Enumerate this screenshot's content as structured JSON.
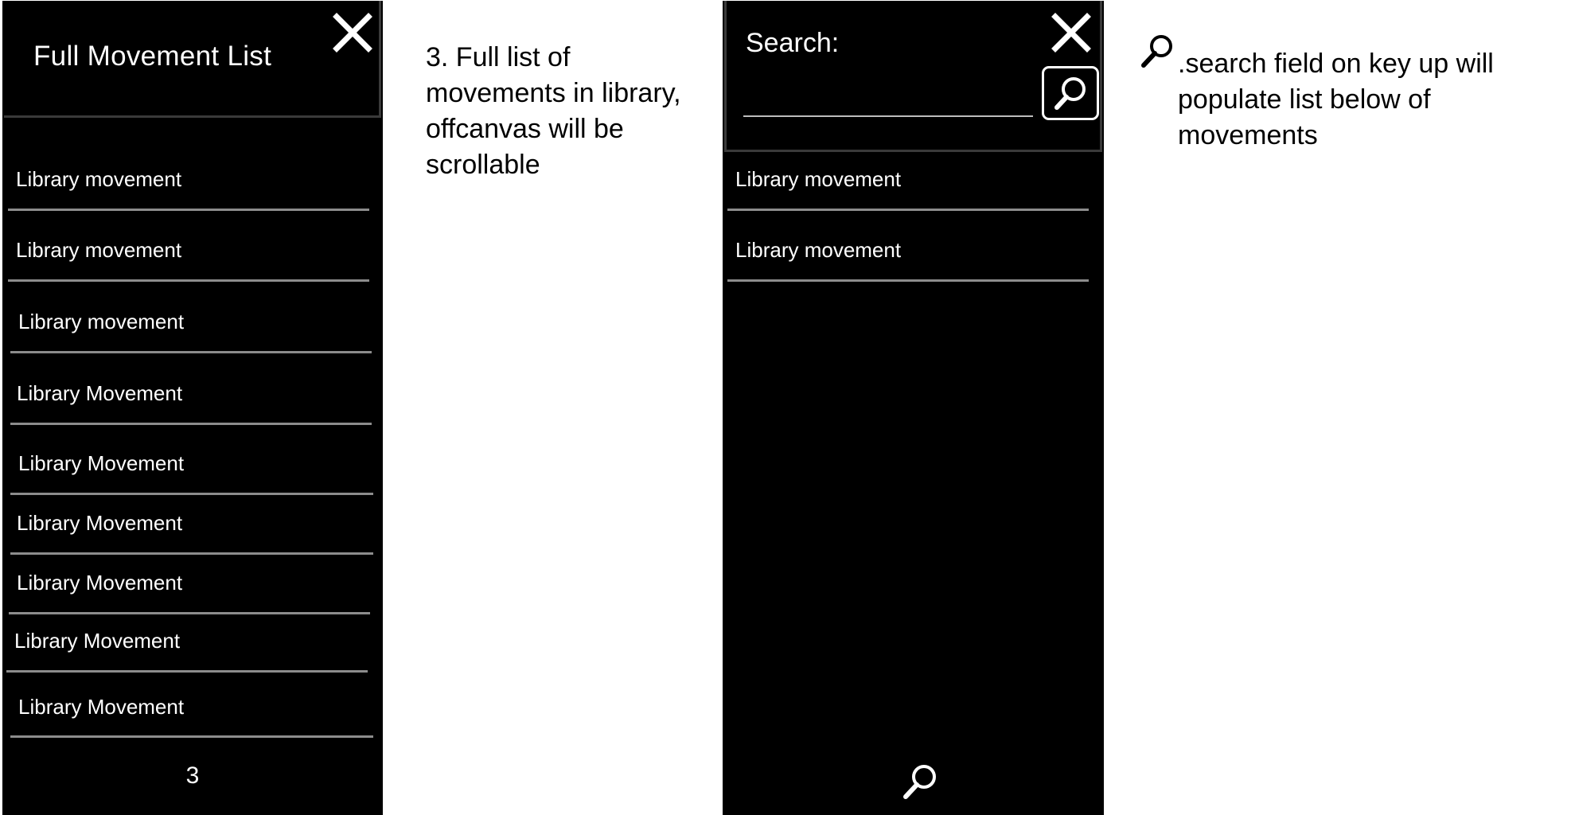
{
  "full_list_panel": {
    "title": "Full Movement List",
    "items": [
      "Library movement",
      "Library movement",
      "Library movement",
      "Library Movement",
      "Library Movement",
      "Library Movement",
      "Library Movement",
      "Library Movement",
      "Library Movement"
    ],
    "page_number": "3"
  },
  "annotation_list": "3. Full list of movements in library, offcanvas will be scrollable",
  "search_panel": {
    "search_label": "Search:",
    "search_value": "",
    "results": [
      "Library movement",
      "Library movement"
    ]
  },
  "annotation_search": ".search field on key up will populate list below of movements",
  "colors": {
    "panel_background": "#000000",
    "divider": "#8c8c8c",
    "text": "#ffffff"
  }
}
